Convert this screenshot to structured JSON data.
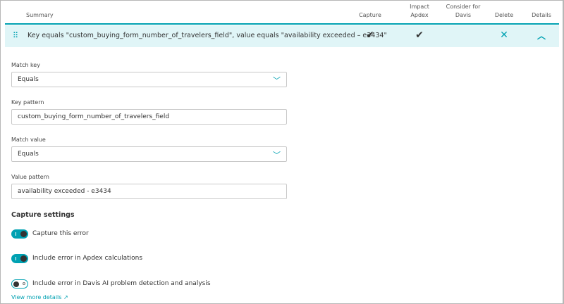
{
  "table": {
    "headers": {
      "summary": "Summary",
      "capture": "Capture",
      "impact_apdex": "Impact\nApdex",
      "consider_davis": "Consider for\nDavis",
      "delete": "Delete",
      "details": "Details"
    },
    "row": {
      "summary": "Key equals \"custom_buying_form_number_of_travelers_field\", value equals \"availability exceeded – e3434\"",
      "capture": true,
      "impact_apdex": true,
      "consider_davis": false,
      "icons": {
        "drag": "drag-handle-icon",
        "check": "checkmark-icon",
        "delete": "close-x-icon",
        "details": "chevron-up-icon"
      }
    }
  },
  "form": {
    "match_key": {
      "label": "Match key",
      "value": "Equals"
    },
    "key_pattern": {
      "label": "Key pattern",
      "value": "custom_buying_form_number_of_travelers_field"
    },
    "match_value": {
      "label": "Match value",
      "value": "Equals"
    },
    "value_pattern": {
      "label": "Value pattern",
      "value": "availability exceeded - e3434"
    }
  },
  "capture_settings": {
    "title": "Capture settings",
    "toggles": [
      {
        "label": "Capture this error",
        "on": true
      },
      {
        "label": "Include error in Apdex calculations",
        "on": true
      },
      {
        "label": "Include error in Davis AI problem detection and analysis",
        "on": false
      }
    ],
    "link": "View more details"
  },
  "colors": {
    "accent": "#00a1b2",
    "row_highlight": "#e0f5f7"
  }
}
